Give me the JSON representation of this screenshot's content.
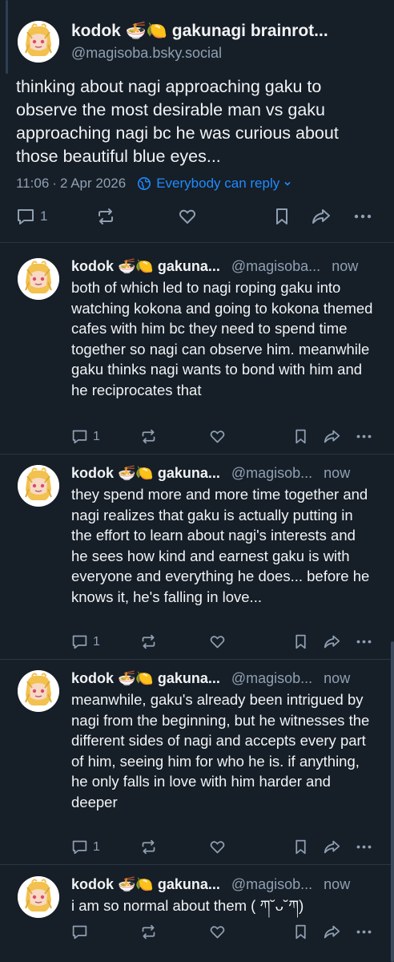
{
  "main_post": {
    "display_name": "kodok 🍜🍋 gakunagi brainrot...",
    "handle": "@magisoba.bsky.social",
    "text": "thinking about nagi approaching gaku to observe the most desirable man vs gaku approaching nagi bc he was curious about those beautiful blue eyes...",
    "time": "11:06",
    "date": "2 Apr 2026",
    "reply_permission": "Everybody can reply",
    "reply_count": "1"
  },
  "replies": [
    {
      "display_name": "kodok 🍜🍋 gakuna...",
      "handle": "@magisoba...",
      "time": "now",
      "text": "both of which led to nagi roping gaku into watching kokona and going to kokona themed cafes with him bc they need to spend time together so nagi can observe him. meanwhile gaku thinks nagi wants to bond with him and he reciprocates that",
      "reply_count": "1"
    },
    {
      "display_name": "kodok 🍜🍋 gakuna...",
      "handle": "@magisob...",
      "time": "now",
      "text": "they spend more and more time together and nagi realizes that gaku is actually putting in the effort to learn about nagi's interests and he sees how kind and earnest gaku is with everyone and everything he does... before he knows it, he's falling in love...",
      "reply_count": "1"
    },
    {
      "display_name": "kodok 🍜🍋 gakuna...",
      "handle": "@magisob...",
      "time": "now",
      "text": "meanwhile, gaku's already been intrigued by nagi from the beginning, but he witnesses the different sides of nagi and accepts every part of him, seeing him for who he is. if anything, he only falls in love with him harder and deeper",
      "reply_count": "1"
    },
    {
      "display_name": "kodok 🍜🍋 gakuna...",
      "handle": "@magisob...",
      "time": "now",
      "text": "i am so normal about them ( ཀ˘ᴗ˘ཀ)",
      "reply_count": ""
    }
  ],
  "colors": {
    "background": "#161e27",
    "text": "#f1f3f5",
    "muted": "#8fa0b3",
    "accent": "#208bfe",
    "divider": "#2a3644"
  }
}
